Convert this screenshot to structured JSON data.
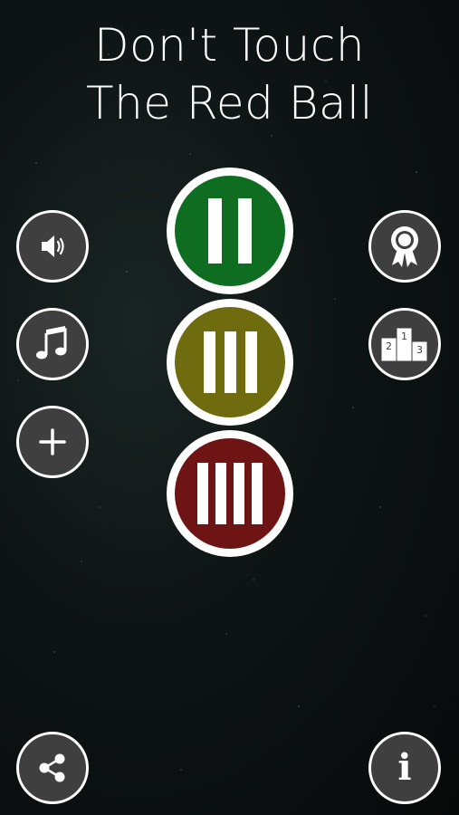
{
  "title": {
    "line1": "Don't Touch",
    "line2": "The Red Ball"
  },
  "left_buttons": [
    {
      "icon": "speaker-icon"
    },
    {
      "icon": "music-note-icon"
    },
    {
      "icon": "plus-icon"
    }
  ],
  "right_buttons": [
    {
      "icon": "award-ribbon-icon"
    },
    {
      "icon": "podium-leaderboard-icon",
      "labels": [
        "1",
        "2",
        "3"
      ]
    }
  ],
  "levels": [
    {
      "bars": 2,
      "color": "#0f6d22"
    },
    {
      "bars": 3,
      "color": "#6f6c10"
    },
    {
      "bars": 4,
      "color": "#6f1414"
    }
  ],
  "bottom_buttons": [
    {
      "icon": "share-icon"
    },
    {
      "icon": "info-icon",
      "label": "i"
    }
  ]
}
